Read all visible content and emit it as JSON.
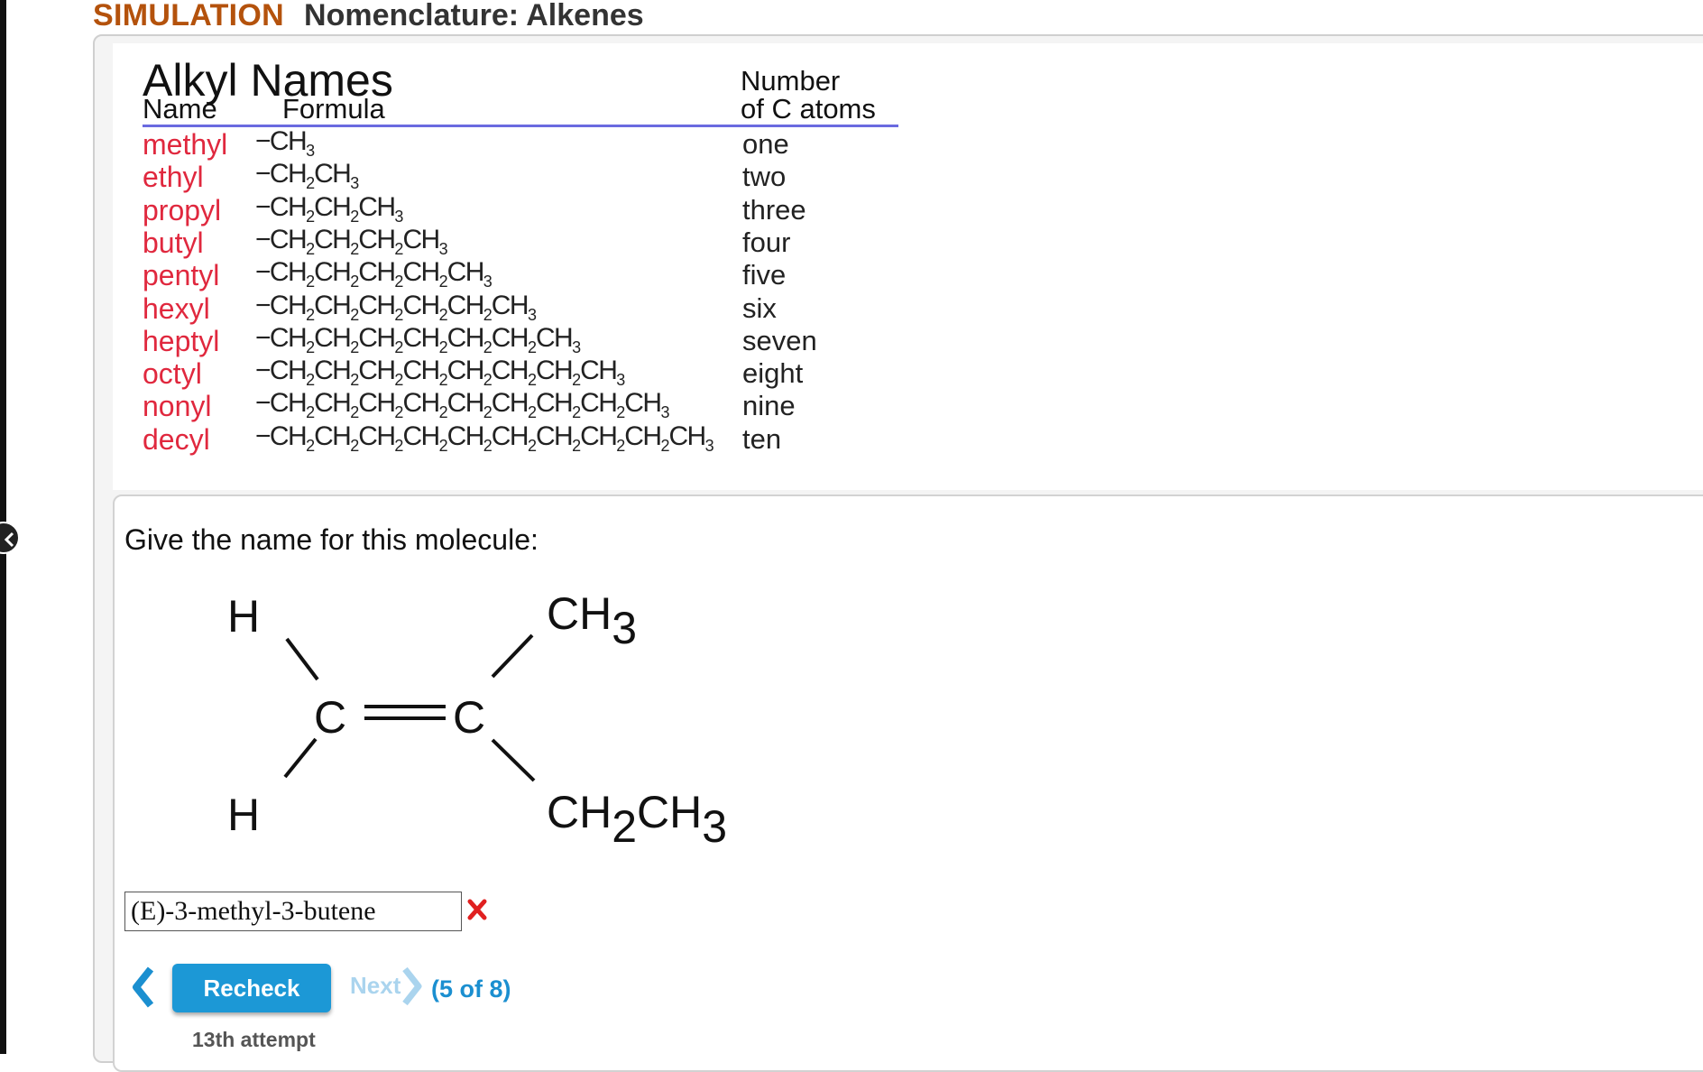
{
  "header": {
    "label": "SIMULATION",
    "title": "Nomenclature: Alkenes"
  },
  "alkyl_table": {
    "title": "Alkyl Names",
    "col_name": "Name",
    "col_formula": "Formula",
    "col_count_line1": "Number",
    "col_count_line2": "of C atoms",
    "rows": [
      {
        "name": "methyl",
        "formula": "−CH3",
        "count": "one"
      },
      {
        "name": "ethyl",
        "formula": "−CH2CH3",
        "count": "two"
      },
      {
        "name": "propyl",
        "formula": "−CH2CH2CH3",
        "count": "three"
      },
      {
        "name": "butyl",
        "formula": "−CH2CH2CH2CH3",
        "count": "four"
      },
      {
        "name": "pentyl",
        "formula": "−CH2CH2CH2CH2CH3",
        "count": "five"
      },
      {
        "name": "hexyl",
        "formula": "−CH2CH2CH2CH2CH2CH3",
        "count": "six"
      },
      {
        "name": "heptyl",
        "formula": "−CH2CH2CH2CH2CH2CH2CH3",
        "count": "seven"
      },
      {
        "name": "octyl",
        "formula": "−CH2CH2CH2CH2CH2CH2CH2CH3",
        "count": "eight"
      },
      {
        "name": "nonyl",
        "formula": "−CH2CH2CH2CH2CH2CH2CH2CH2CH3",
        "count": "nine"
      },
      {
        "name": "decyl",
        "formula": "−CH2CH2CH2CH2CH2CH2CH2CH2CH2CH3",
        "count": "ten"
      }
    ]
  },
  "question": {
    "prompt": "Give the name for this molecule:",
    "molecule": {
      "h_top": "H",
      "h_bottom": "H",
      "c_left": "C",
      "c_right": "C",
      "ch3_main": "CH",
      "ch3_sub": "3",
      "ethyl_a": "CH",
      "ethyl_a_sub": "2",
      "ethyl_b": "CH",
      "ethyl_b_sub": "3"
    },
    "answer_value": "(E)-3-methyl-3-butene",
    "answer_status": "incorrect"
  },
  "nav": {
    "recheck_label": "Recheck",
    "next_label": "Next",
    "progress": "(5 of 8)",
    "attempt": "13th attempt"
  },
  "colors": {
    "accent": "#1c98d6",
    "alkyl_name": "#e0283e",
    "header_label": "#b4520c",
    "wrong": "#e02020"
  }
}
